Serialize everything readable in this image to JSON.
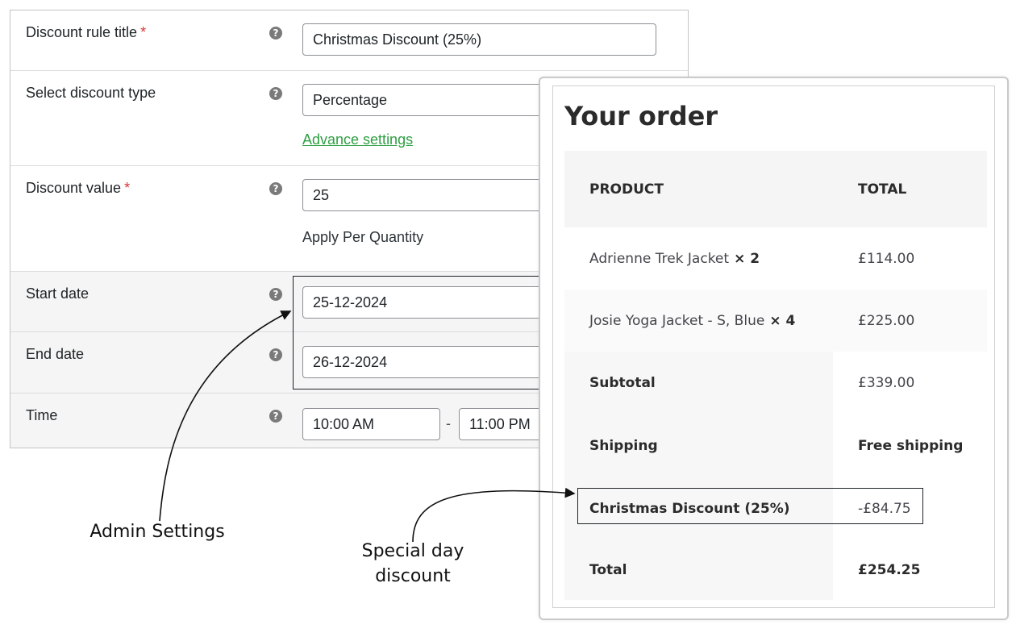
{
  "admin": {
    "rows": [
      {
        "label": "Discount rule title",
        "required_mark": "*",
        "value": "Christmas Discount (25%)"
      },
      {
        "label": "Select discount type",
        "value": "Percentage",
        "link": "Advance settings"
      },
      {
        "label": "Discount value",
        "required_mark": "*",
        "value": "25",
        "note": "Apply Per Quantity"
      },
      {
        "label": "Start date",
        "value": "25-12-2024"
      },
      {
        "label": "End date",
        "value": "26-12-2024"
      },
      {
        "label": "Time",
        "start": "10:00 AM",
        "separator": "-",
        "end": "11:00 PM"
      }
    ],
    "help_glyph": "?"
  },
  "order": {
    "title": "Your order",
    "header": {
      "product": "PRODUCT",
      "total": "TOTAL"
    },
    "items": [
      {
        "name": "Adrienne Trek Jacket",
        "qty": "× 2",
        "total": "£114.00"
      },
      {
        "name": "Josie Yoga Jacket - S, Blue",
        "qty": "× 4",
        "total": "£225.00"
      }
    ],
    "subtotal": {
      "label": "Subtotal",
      "value": "£339.00"
    },
    "shipping": {
      "label": "Shipping",
      "value": "Free shipping"
    },
    "discount": {
      "label": "Christmas Discount (25%)",
      "value": "-£84.75"
    },
    "total": {
      "label": "Total",
      "value": "£254.25"
    }
  },
  "annotations": {
    "admin_settings": "Admin Settings",
    "special_day_line1": "Special day",
    "special_day_line2": "discount"
  }
}
